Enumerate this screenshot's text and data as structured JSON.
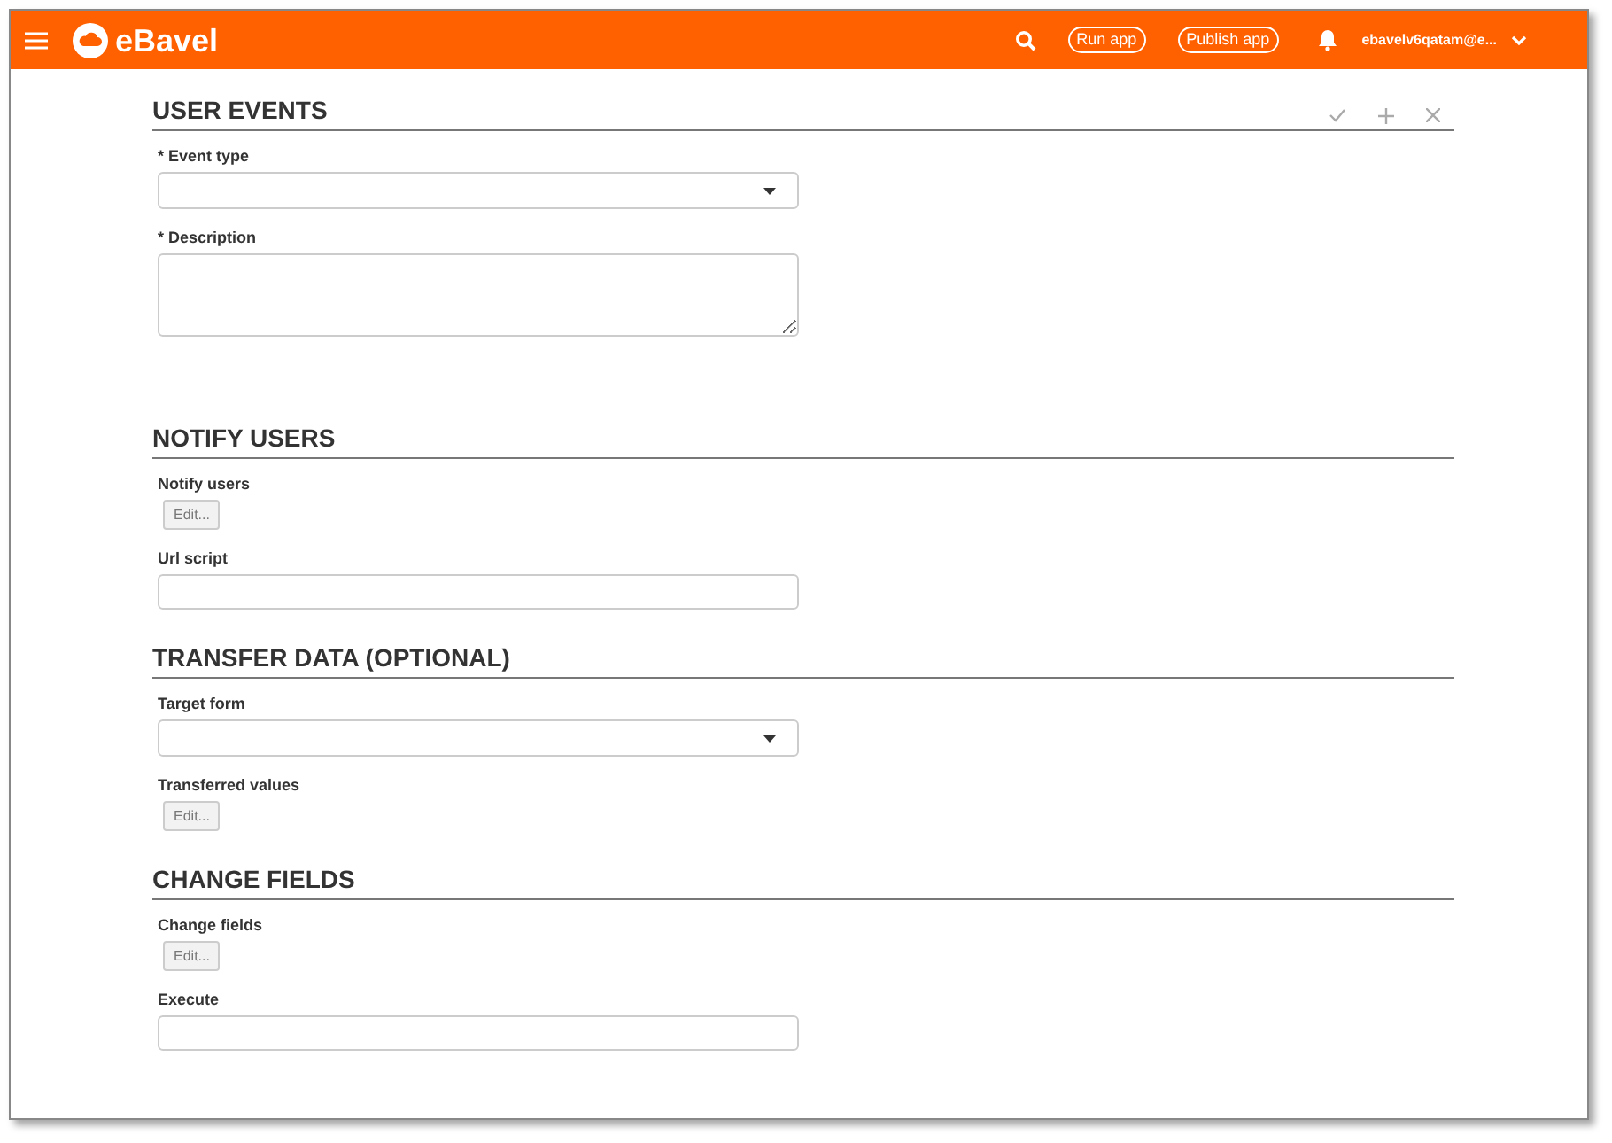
{
  "header": {
    "brand": "eBavel",
    "buttons": [
      "Run app",
      "Publish app"
    ],
    "user": "ebavelv6qatam@e..."
  },
  "sections": [
    {
      "title": "USER EVENTS",
      "actions": true,
      "fields": [
        {
          "kind": "select",
          "label": "* Event type"
        },
        {
          "kind": "textarea",
          "label": "* Description"
        }
      ]
    },
    {
      "title": "NOTIFY USERS",
      "actions": false,
      "fields": [
        {
          "kind": "button",
          "label": "Notify users",
          "button": "Edit..."
        },
        {
          "kind": "text",
          "label": "Url script"
        }
      ]
    },
    {
      "title": "TRANSFER DATA (OPTIONAL)",
      "actions": false,
      "fields": [
        {
          "kind": "select",
          "label": "Target form"
        },
        {
          "kind": "button",
          "label": "Transferred values",
          "button": "Edit..."
        }
      ]
    },
    {
      "title": "CHANGE FIELDS",
      "actions": false,
      "fields": [
        {
          "kind": "button",
          "label": "Change fields",
          "button": "Edit..."
        },
        {
          "kind": "text",
          "label": "Execute"
        }
      ]
    }
  ]
}
